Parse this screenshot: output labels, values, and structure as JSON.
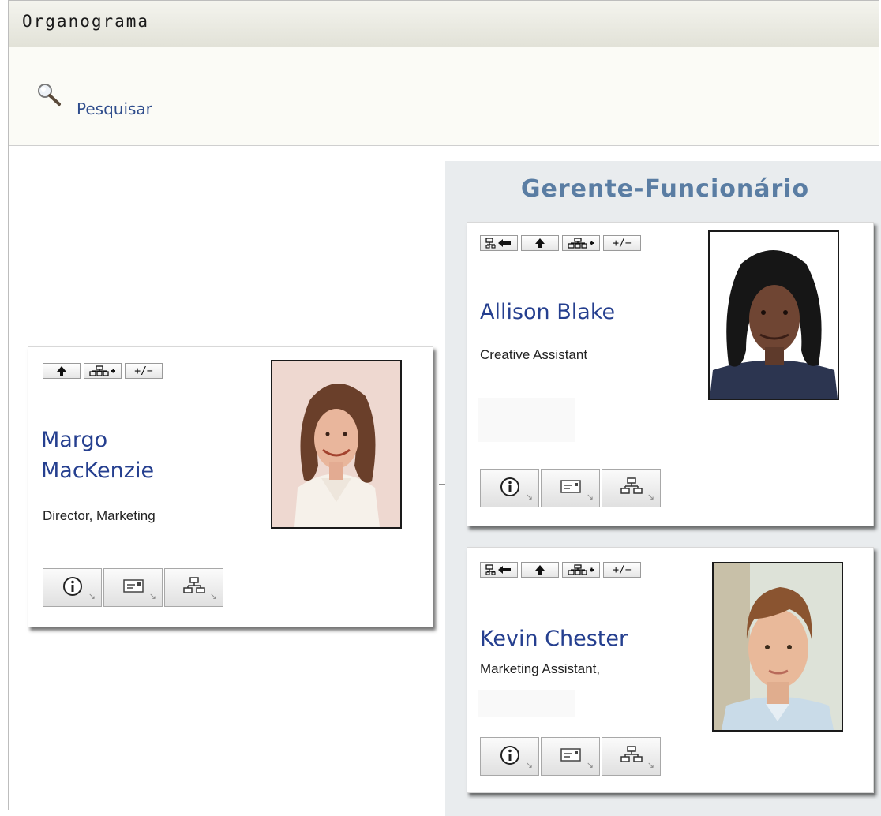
{
  "app": {
    "title": "Organograma"
  },
  "toolbar": {
    "search_label": "Pesquisar",
    "search_icon": "magnifier-icon"
  },
  "panel": {
    "title": "Gerente-Funcionário",
    "background": "#e9ecee"
  },
  "colors": {
    "name_link": "#253f8f",
    "panel_title": "#5a7da3",
    "search_link": "#2e4c8c"
  },
  "icons": {
    "action_buttons": [
      "show-manager-icon",
      "go-up-icon",
      "expand-reports-icon",
      "expand-collapse-icon"
    ],
    "action_expand_label": "+/−",
    "detail_buttons": [
      "info-icon",
      "email-icon",
      "org-chart-icon"
    ],
    "dropdown_glyph": "↘"
  },
  "people": [
    {
      "id": "margo",
      "name_line1": "Margo",
      "name_line2": "MacKenzie",
      "role": "Director, Marketing"
    },
    {
      "id": "allison",
      "name": "Allison Blake",
      "role": "Creative Assistant"
    },
    {
      "id": "kevin",
      "name": "Kevin Chester",
      "role": "Marketing Assistant,"
    }
  ]
}
